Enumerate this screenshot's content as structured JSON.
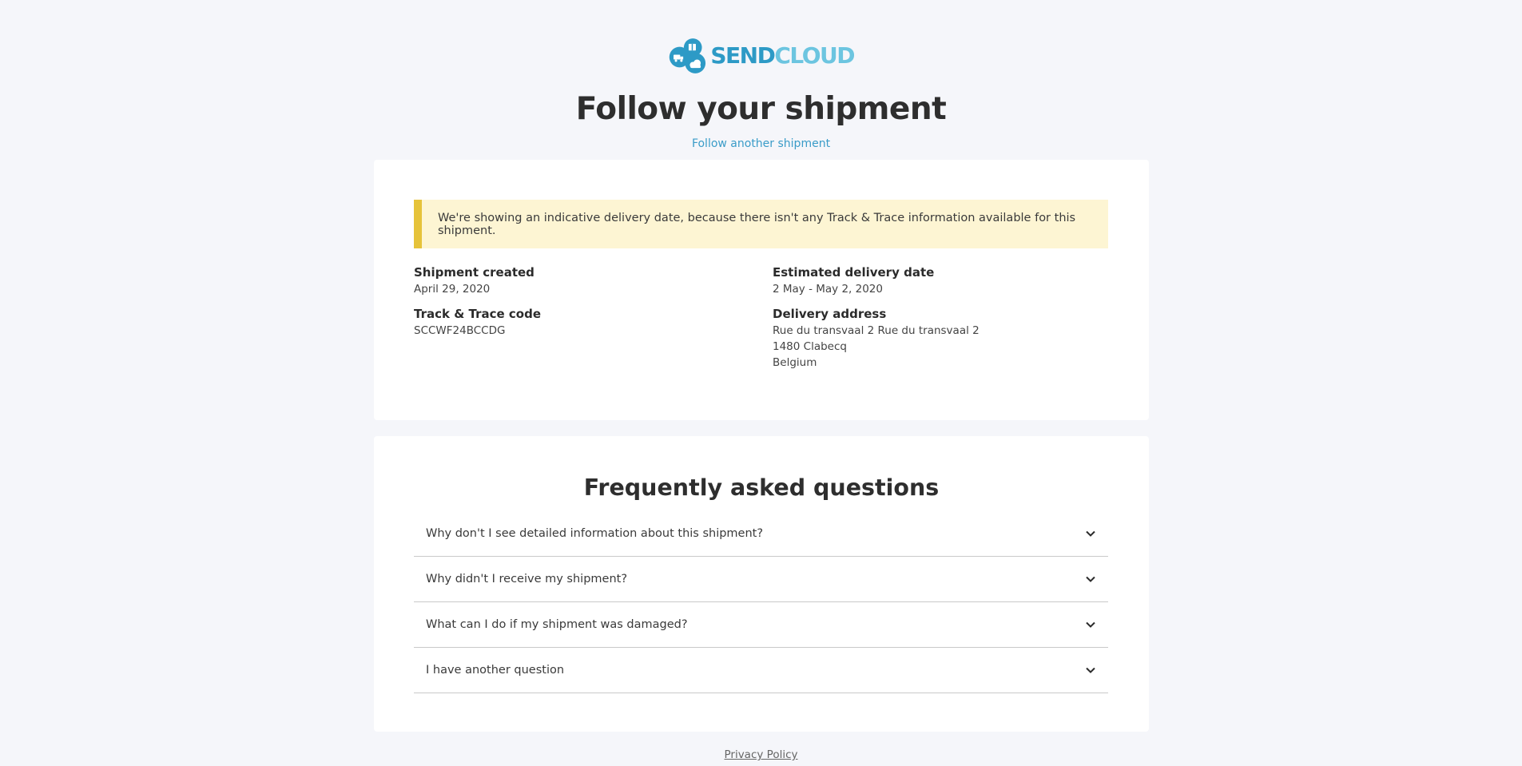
{
  "header": {
    "logo_text_send": "SEND",
    "logo_text_cloud": "CLOUD",
    "title": "Follow your shipment",
    "follow_another_link": "Follow another shipment"
  },
  "shipment": {
    "notice": "We're showing an indicative delivery date, because there isn't any Track & Trace information available for this shipment.",
    "created_label": "Shipment created",
    "created_value": "April 29, 2020",
    "track_label": "Track & Trace code",
    "track_value": "SCCWF24BCCDG",
    "eta_label": "Estimated delivery date",
    "eta_value": "2 May - May 2, 2020",
    "address_label": "Delivery address",
    "address_lines": [
      "Rue du transvaal 2 Rue du transvaal 2",
      "1480 Clabecq",
      "Belgium"
    ]
  },
  "faq": {
    "title": "Frequently asked questions",
    "items": [
      {
        "question": "Why don't I see detailed information about this shipment?"
      },
      {
        "question": "Why didn't I receive my shipment?"
      },
      {
        "question": "What can I do if my shipment was damaged?"
      },
      {
        "question": "I have another question"
      }
    ]
  },
  "footer": {
    "privacy_link": "Privacy Policy"
  },
  "colors": {
    "brand_blue": "#2d9ac6",
    "brand_light_blue": "#6cc5e0",
    "notice_bg": "#fdf5d3",
    "notice_border": "#e6c33a"
  }
}
